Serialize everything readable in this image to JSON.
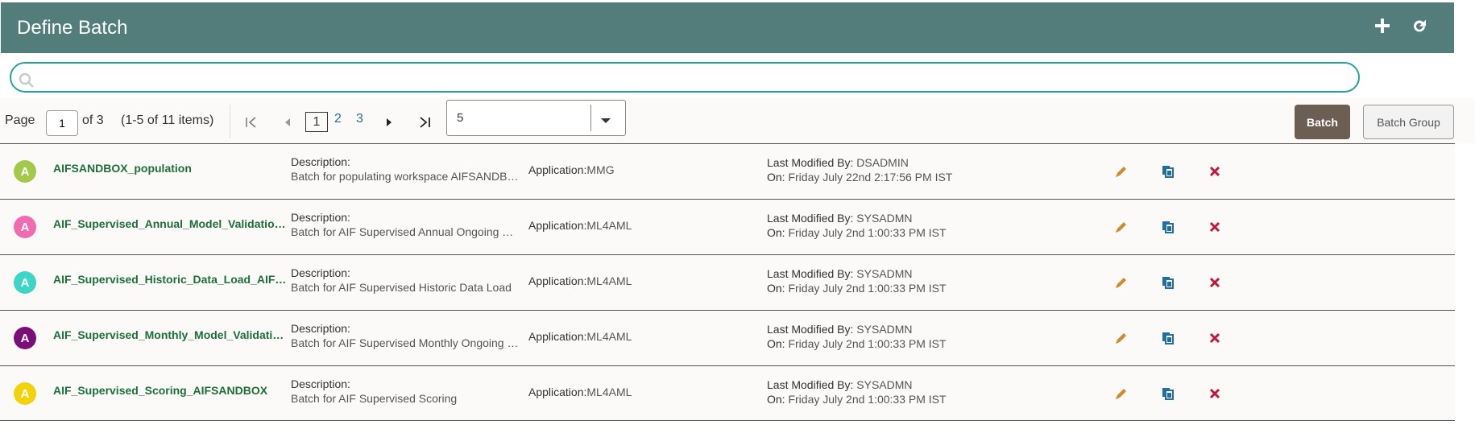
{
  "header": {
    "title": "Define Batch",
    "add_icon": "plus-icon",
    "refresh_icon": "refresh-icon"
  },
  "search": {
    "value": "",
    "placeholder": ""
  },
  "pager": {
    "page_label": "Page",
    "current_page": "1",
    "of_label": "of 3",
    "items_label": "(1-5 of 11 items)",
    "pages": [
      "1",
      "2",
      "3"
    ],
    "page_size": "5"
  },
  "toggle": {
    "batch": "Batch",
    "batch_group": "Batch Group"
  },
  "labels": {
    "description": "Description:",
    "application": "Application:",
    "modified_by": "Last Modified By: ",
    "on": "On: "
  },
  "rows": [
    {
      "avatar": "A",
      "avatar_color": "#a3c94a",
      "name": "AIFSANDBOX_population",
      "description": "Batch for populating workspace AIFSANDBOX",
      "application": "MMG",
      "modified_by": "DSADMIN",
      "modified_on": "Friday July 22nd 2:17:56 PM IST"
    },
    {
      "avatar": "A",
      "avatar_color": "#f06bb0",
      "name": "AIF_Supervised_Annual_Model_Validation_AIFSANDBOX",
      "description": "Batch for AIF Supervised Annual Ongoing Model Validation",
      "application": "ML4AML",
      "modified_by": "SYSADMN",
      "modified_on": "Friday July 2nd 1:00:33 PM IST"
    },
    {
      "avatar": "A",
      "avatar_color": "#3dd6c6",
      "name": "AIF_Supervised_Historic_Data_Load_AIFSANDBOX",
      "description": "Batch for AIF Supervised Historic Data Load",
      "application": "ML4AML",
      "modified_by": "SYSADMN",
      "modified_on": "Friday July 2nd 1:00:33 PM IST"
    },
    {
      "avatar": "A",
      "avatar_color": "#7a0f7a",
      "name": "AIF_Supervised_Monthly_Model_Validation_AIFSANDBOX",
      "description": "Batch for AIF Supervised Monthly Ongoing Model Validation",
      "application": "ML4AML",
      "modified_by": "SYSADMN",
      "modified_on": "Friday July 2nd 1:00:33 PM IST"
    },
    {
      "avatar": "A",
      "avatar_color": "#f2d20b",
      "name": "AIF_Supervised_Scoring_AIFSANDBOX",
      "description": "Batch for AIF Supervised Scoring",
      "application": "ML4AML",
      "modified_by": "SYSADMN",
      "modified_on": "Friday July 2nd 1:00:33 PM IST"
    }
  ],
  "colors": {
    "header_bg": "#527d7a",
    "edit": "#d08a2a",
    "copy": "#1f6fa0",
    "delete": "#c0163a"
  }
}
